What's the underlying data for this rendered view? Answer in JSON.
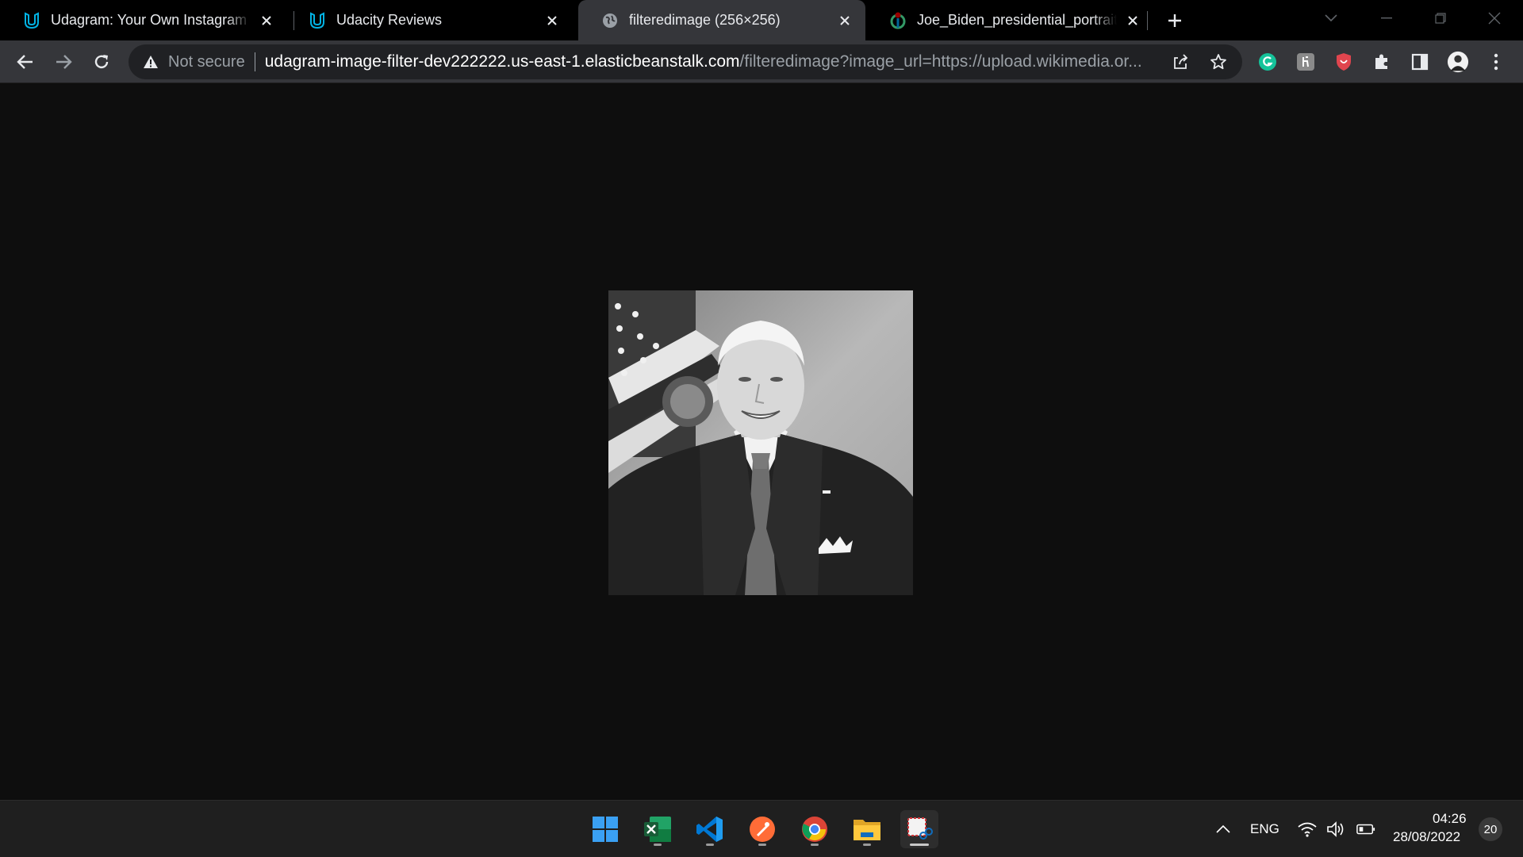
{
  "browser": {
    "tabs": [
      {
        "title": "Udagram: Your Own Instagram on AWS",
        "favicon": "udacity-icon",
        "active": false
      },
      {
        "title": "Udacity Reviews",
        "favicon": "udacity-icon",
        "active": false
      },
      {
        "title": "filteredimage (256×256)",
        "favicon": "globe-icon",
        "active": true
      },
      {
        "title": "Joe_Biden_presidential_portrait.jpg",
        "favicon": "wikimedia-icon",
        "active": false
      }
    ],
    "omnibox": {
      "security_label": "Not secure",
      "url_host": "udagram-image-filter-dev222222.us-east-1.elasticbeanstalk.com",
      "url_path": "/filteredimage?image_url=https://upload.wikimedia.or..."
    }
  },
  "content": {
    "image_alt": "filteredimage"
  },
  "taskbar": {
    "apps": [
      "start-icon",
      "excel-icon",
      "vscode-icon",
      "postman-icon",
      "chrome-icon",
      "file-explorer-icon",
      "snipping-tool-icon"
    ],
    "language": "ENG",
    "time": "04:26",
    "date": "28/08/2022",
    "notifications": "20"
  },
  "colors": {
    "accent_udacity": "#02b3e4",
    "page_bg": "#0e0e0e",
    "tab_active": "#35363a"
  }
}
